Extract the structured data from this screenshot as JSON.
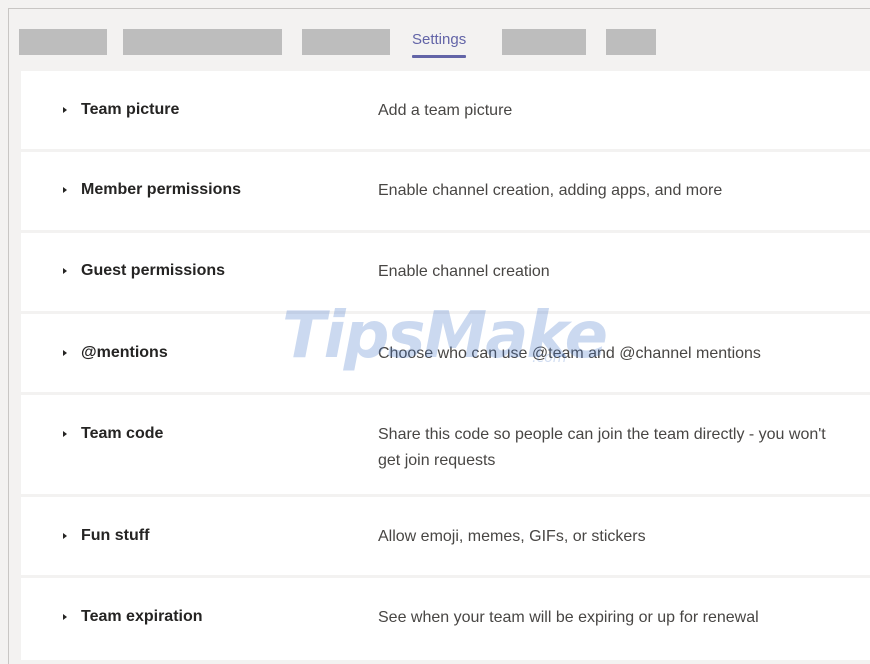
{
  "tabs": {
    "active_label": "Settings"
  },
  "settings": [
    {
      "title": "Team picture",
      "description": "Add a team picture"
    },
    {
      "title": "Member permissions",
      "description": "Enable channel creation, adding apps, and more"
    },
    {
      "title": "Guest permissions",
      "description": "Enable channel creation"
    },
    {
      "title": "@mentions",
      "description": "Choose who can use @team and @channel mentions"
    },
    {
      "title": "Team code",
      "description": "Share this code so people can join the team directly - you won't get join requests"
    },
    {
      "title": "Fun stuff",
      "description": "Allow emoji, memes, GIFs, or stickers"
    },
    {
      "title": "Team expiration",
      "description": "See when your team will be expiring or up for renewal"
    }
  ],
  "watermark": {
    "text": "TipsMake",
    "suffix": ".com"
  },
  "colors": {
    "accent": "#6264a7",
    "placeholder_gray": "#bdbdbd",
    "row_background": "#ffffff",
    "page_background": "#f3f2f1"
  }
}
